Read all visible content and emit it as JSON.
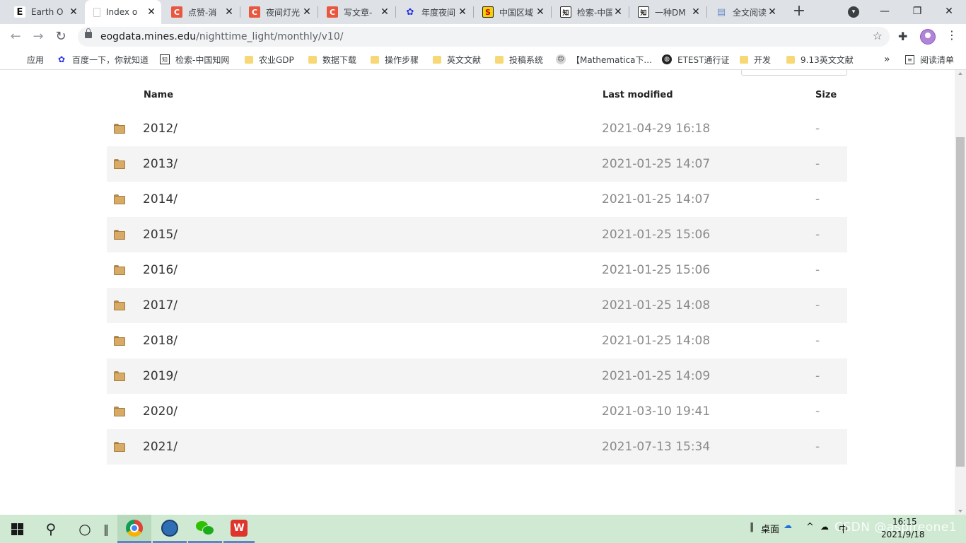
{
  "tabs": [
    {
      "favicon_text": "E",
      "favicon_color": "#111111",
      "label": "Earth O",
      "active": false
    },
    {
      "favicon_text": "",
      "favicon_color": "#ffffff",
      "label": "Index o",
      "active": true
    },
    {
      "favicon_text": "C",
      "favicon_color": "#e8573f",
      "label": "点赞-消",
      "active": false
    },
    {
      "favicon_text": "C",
      "favicon_color": "#e8573f",
      "label": "夜间灯光",
      "active": false
    },
    {
      "favicon_text": "C",
      "favicon_color": "#e8573f",
      "label": "写文章-",
      "active": false
    },
    {
      "favicon_text": "✿",
      "favicon_color": "#2932e1",
      "label": "年度夜间",
      "active": false
    },
    {
      "favicon_text": "S",
      "favicon_color": "#f7d100",
      "label": "中国区域",
      "active": false
    },
    {
      "favicon_text": "知",
      "favicon_color": "#ffffff",
      "label": "检索-中国",
      "active": false
    },
    {
      "favicon_text": "知",
      "favicon_color": "#ffffff",
      "label": "一种DM",
      "active": false
    },
    {
      "favicon_text": "▤",
      "favicon_color": "#ffffff",
      "label": "全文阅读",
      "active": false
    }
  ],
  "tab_close_glyph": "✕",
  "new_tab_glyph": "+",
  "toolbar": {
    "back_glyph": "←",
    "forward_glyph": "→",
    "reload_glyph": "↻",
    "url_host": "eogdata.mines.edu",
    "url_path": "/nighttime_light/monthly/v10/",
    "star_glyph": "☆",
    "extensions_glyph": "✚",
    "menu_glyph": "⋮"
  },
  "window_controls": {
    "minimize": "—",
    "restore": "❐",
    "close": "✕"
  },
  "bookmarks": [
    {
      "icon": "apps",
      "label": "应用"
    },
    {
      "icon": "baidu",
      "label": "百度一下，你就知道"
    },
    {
      "icon": "cnki",
      "label": "检索-中国知网"
    },
    {
      "icon": "folder",
      "label": "农业GDP"
    },
    {
      "icon": "folder",
      "label": "数据下载"
    },
    {
      "icon": "folder",
      "label": "操作步骤"
    },
    {
      "icon": "folder",
      "label": "英文文献"
    },
    {
      "icon": "folder",
      "label": "投稿系统"
    },
    {
      "icon": "mathematica",
      "label": "【Mathematica下..."
    },
    {
      "icon": "globe",
      "label": "ETEST通行证"
    },
    {
      "icon": "folder",
      "label": "开发"
    },
    {
      "icon": "folder",
      "label": "9.13英文文献"
    }
  ],
  "bookmarks_more_glyph": "»",
  "reading_list_label": "阅读清单",
  "listing": {
    "columns": {
      "name": "Name",
      "last_modified": "Last modified",
      "size": "Size"
    },
    "rows": [
      {
        "name": "2012/",
        "modified": "2021-04-29 16:18",
        "size": "-"
      },
      {
        "name": "2013/",
        "modified": "2021-01-25 14:07",
        "size": "-"
      },
      {
        "name": "2014/",
        "modified": "2021-01-25 14:07",
        "size": "-"
      },
      {
        "name": "2015/",
        "modified": "2021-01-25 15:06",
        "size": "-"
      },
      {
        "name": "2016/",
        "modified": "2021-01-25 15:06",
        "size": "-"
      },
      {
        "name": "2017/",
        "modified": "2021-01-25 14:08",
        "size": "-"
      },
      {
        "name": "2018/",
        "modified": "2021-01-25 14:08",
        "size": "-"
      },
      {
        "name": "2019/",
        "modified": "2021-01-25 14:09",
        "size": "-"
      },
      {
        "name": "2020/",
        "modified": "2021-03-10 19:41",
        "size": "-"
      },
      {
        "name": "2021/",
        "modified": "2021-07-13 15:34",
        "size": "-"
      }
    ]
  },
  "taskbar": {
    "search_glyph": "⚲",
    "cortana_glyph": "○",
    "taskview_glyph": "‖",
    "wps_label": "W",
    "desktop_label": "桌面",
    "tray_expand_glyph": "^",
    "ime_label": "中",
    "watermark": "CSDN @aspireone1",
    "time": "16:15",
    "date": "2021/9/18"
  }
}
